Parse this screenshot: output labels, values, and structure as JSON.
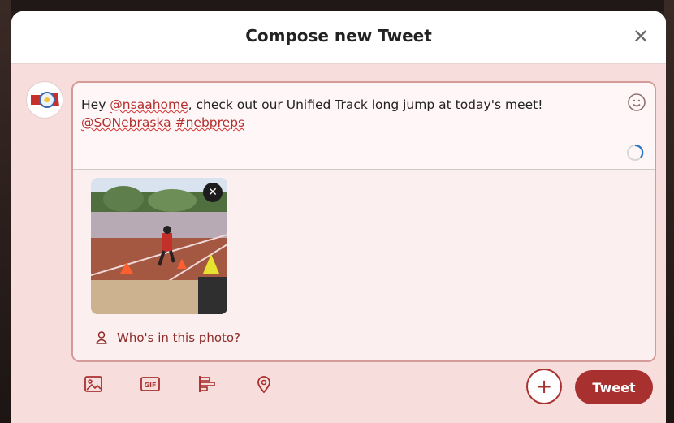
{
  "modal": {
    "title": "Compose new Tweet",
    "close_glyph": "✕"
  },
  "composer": {
    "text_prefix": "Hey ",
    "mention_1": "@nsaahome",
    "text_middle": ", check out our Unified Track long jump at today's meet!",
    "mention_2": "@SONebraska",
    "hashtag": "#nebpreps",
    "emoji_icon": "smiley-icon",
    "progress_icon": "character-count-ring-icon"
  },
  "media": {
    "remove_glyph": "✕",
    "tag_people_label": "Who's in this photo?"
  },
  "toolbar": {
    "icons": [
      "image-icon",
      "gif-icon",
      "poll-icon",
      "location-icon"
    ],
    "gif_label": "GIF",
    "add_glyph": "+",
    "tweet_label": "Tweet"
  },
  "colors": {
    "accent": "#a8302e",
    "mention": "#b3302f",
    "modal_bg": "#f7dedd"
  }
}
